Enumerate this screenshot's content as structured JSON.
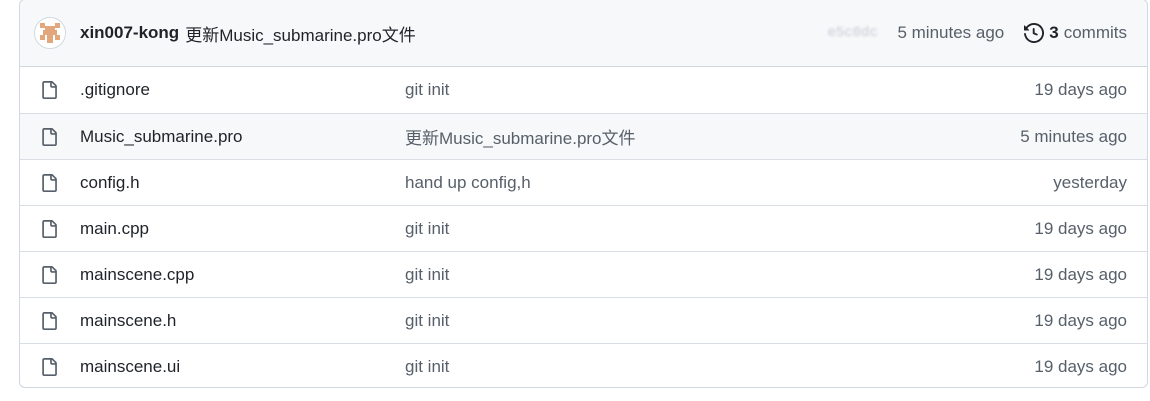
{
  "latest_commit": {
    "author": "xin007-kong",
    "message": "更新Music_submarine.pro文件",
    "sha": "e5c0dc",
    "time": "5 minutes ago",
    "commits_count": "3",
    "commits_label": "commits",
    "history_icon": "history-icon",
    "avatar": "identicon-avatar"
  },
  "files": [
    {
      "name": ".gitignore",
      "message": "git init",
      "age": "19 days ago",
      "icon": "file-icon"
    },
    {
      "name": "Music_submarine.pro",
      "message": "更新Music_submarine.pro文件",
      "age": "5 minutes ago",
      "icon": "file-icon"
    },
    {
      "name": "config.h",
      "message": "hand up config,h",
      "age": "yesterday",
      "icon": "file-icon"
    },
    {
      "name": "main.cpp",
      "message": "git init",
      "age": "19 days ago",
      "icon": "file-icon"
    },
    {
      "name": "mainscene.cpp",
      "message": "git init",
      "age": "19 days ago",
      "icon": "file-icon"
    },
    {
      "name": "mainscene.h",
      "message": "git init",
      "age": "19 days ago",
      "icon": "file-icon"
    },
    {
      "name": "mainscene.ui",
      "message": "git init",
      "age": "19 days ago",
      "icon": "file-icon"
    }
  ],
  "colors": {
    "border": "#d0d7de",
    "header_bg": "#f6f8fa",
    "muted_text": "#57606a",
    "avatar_accent": "#e3a77e"
  }
}
